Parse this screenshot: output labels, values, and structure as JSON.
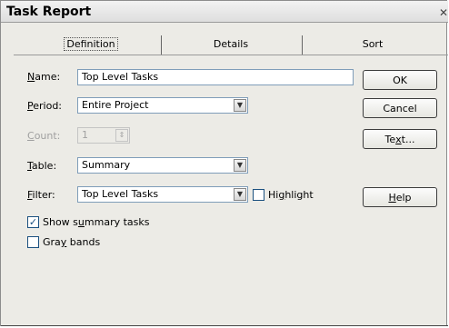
{
  "dialog": {
    "title": "Task Report",
    "close_icon": "close-icon"
  },
  "tabs": [
    "Definition",
    "Details",
    "Sort"
  ],
  "fields": {
    "name_label_pre": "",
    "name_label_key": "N",
    "name_label_post": "ame:",
    "name_value": "Top Level Tasks",
    "period_label_key": "P",
    "period_label_post": "eriod:",
    "period_value": "Entire Project",
    "count_label_key": "C",
    "count_label_post": "ount:",
    "count_value": "1",
    "table_label_key": "T",
    "table_label_post": "able:",
    "table_value": "Summary",
    "filter_label_key": "F",
    "filter_label_post": "ilter:",
    "filter_value": "Top Level Tasks"
  },
  "checks": {
    "highlight_pre": "Hi",
    "highlight_key": "g",
    "highlight_post": "hlight",
    "highlight_checked": false,
    "summary_pre": "Show s",
    "summary_key": "u",
    "summary_post": "mmary tasks",
    "summary_checked": true,
    "gray_pre": "Gra",
    "gray_key": "y",
    "gray_post": " bands",
    "gray_checked": false
  },
  "buttons": {
    "ok": "OK",
    "cancel": "Cancel",
    "text_pre": "Te",
    "text_key": "x",
    "text_post": "t...",
    "help_key": "H",
    "help_post": "elp"
  },
  "icons": {
    "dropdown": "chevron-down-icon",
    "spinner": "spinner-arrows-icon",
    "check": "checkmark-icon"
  }
}
